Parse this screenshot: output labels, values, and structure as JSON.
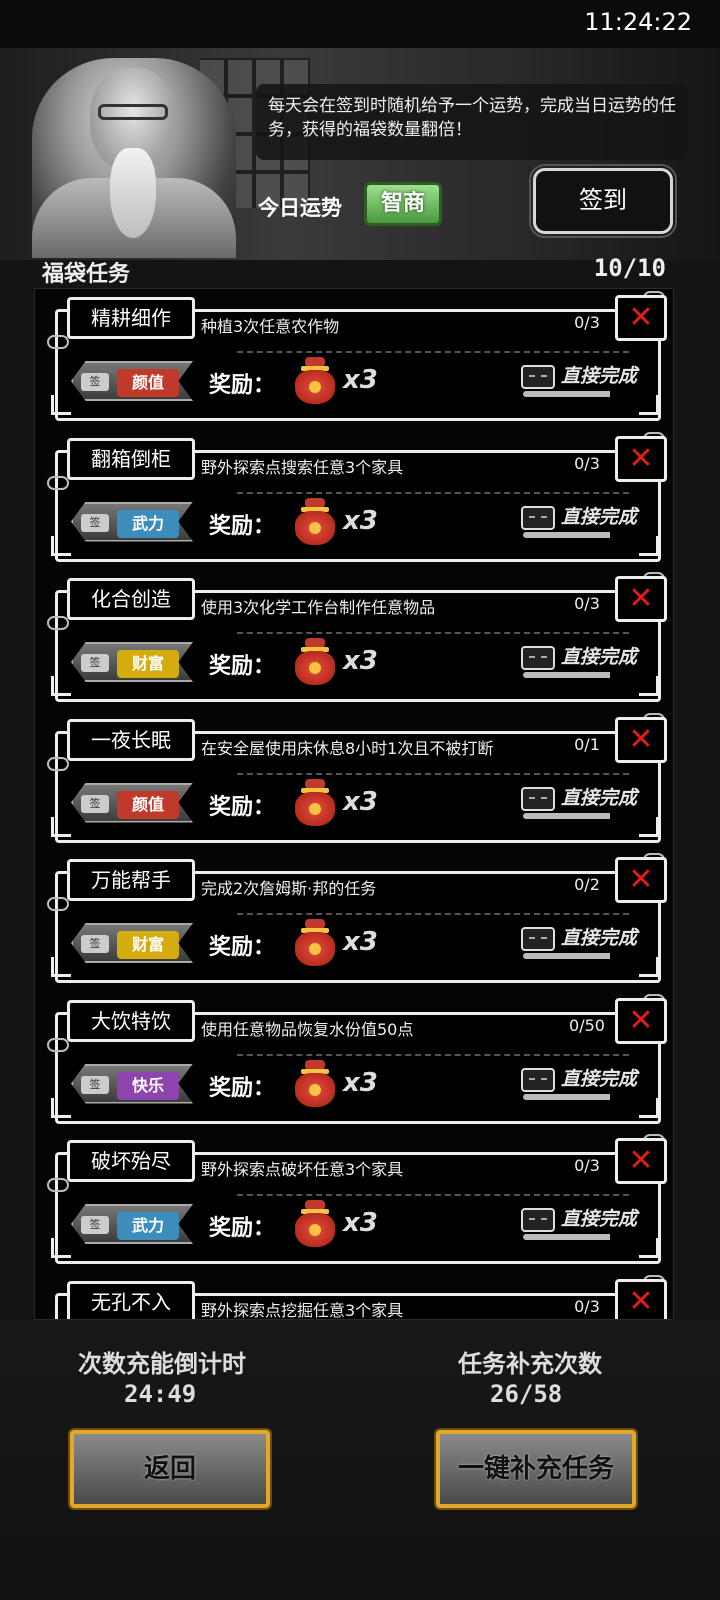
{
  "status_bar": {
    "time": "11:24:22"
  },
  "header": {
    "tip": "每天会在签到时随机给予一个运势，完成当日运势的任务，获得的福袋数量翻倍！",
    "fortune_label": "今日运势",
    "fortune_value": "智商",
    "checkin_label": "签到"
  },
  "section": {
    "title": "福袋任务",
    "count": "10/10"
  },
  "reward_label": "奖励：",
  "complete_label": "直接完成",
  "sign_label": "签",
  "tasks": [
    {
      "name": "精耕细作",
      "desc": "种植3次任意农作物",
      "progress": "0/3",
      "attr": "颜值",
      "attr_color": "#c0392b",
      "reward": "x3"
    },
    {
      "name": "翻箱倒柜",
      "desc": "野外探索点搜索任意3个家具",
      "progress": "0/3",
      "attr": "武力",
      "attr_color": "#3c8dbc",
      "reward": "x3"
    },
    {
      "name": "化合创造",
      "desc": "使用3次化学工作台制作任意物品",
      "progress": "0/3",
      "attr": "财富",
      "attr_color": "#d4ac0d",
      "reward": "x3"
    },
    {
      "name": "一夜长眠",
      "desc": "在安全屋使用床休息8小时1次且不被打断",
      "progress": "0/1",
      "attr": "颜值",
      "attr_color": "#c0392b",
      "reward": "x3"
    },
    {
      "name": "万能帮手",
      "desc": "完成2次詹姆斯·邦的任务",
      "progress": "0/2",
      "attr": "财富",
      "attr_color": "#d4ac0d",
      "reward": "x3"
    },
    {
      "name": "大饮特饮",
      "desc": "使用任意物品恢复水份值50点",
      "progress": "0/50",
      "attr": "快乐",
      "attr_color": "#8e44ad",
      "reward": "x3"
    },
    {
      "name": "破坏殆尽",
      "desc": "野外探索点破坏任意3个家具",
      "progress": "0/3",
      "attr": "武力",
      "attr_color": "#3c8dbc",
      "reward": "x3"
    },
    {
      "name": "无孔不入",
      "desc": "野外探索点挖掘任意3个家具",
      "progress": "0/3",
      "attr": "",
      "attr_color": "#888888",
      "reward": ""
    }
  ],
  "footer": {
    "timer_label": "次数充能倒计时",
    "timer_value": "24:49",
    "refill_label": "任务补充次数",
    "refill_value": "26/58",
    "back_label": "返回",
    "refill_all_label": "一键补充任务"
  },
  "icons": {
    "cancel": "close-icon",
    "reward": "lucky-bag-icon",
    "complete": "ticket-icon"
  }
}
